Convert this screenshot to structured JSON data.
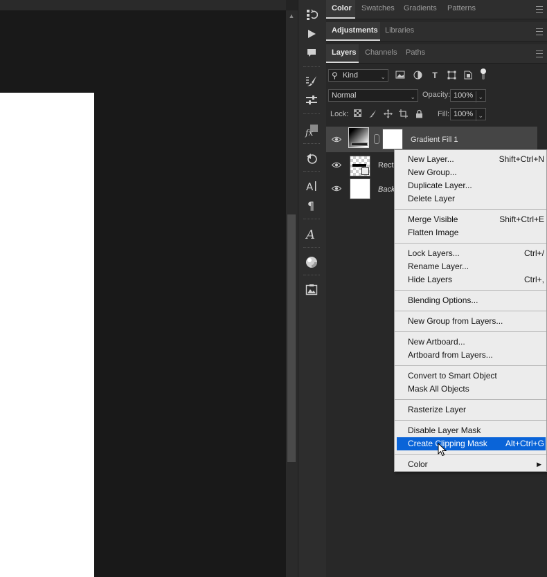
{
  "panels": {
    "row1_tabs": [
      "Color",
      "Swatches",
      "Gradients",
      "Patterns"
    ],
    "row2_tabs": [
      "Adjustments",
      "Libraries"
    ],
    "row3_tabs": [
      "Layers",
      "Channels",
      "Paths"
    ]
  },
  "layers_panel": {
    "filter_kind": "Kind",
    "blend_mode": "Normal",
    "opacity_label": "Opacity:",
    "opacity_value": "100%",
    "lock_label": "Lock:",
    "fill_label": "Fill:",
    "fill_value": "100%",
    "layers": [
      {
        "name": "Gradient Fill 1",
        "selected": true
      },
      {
        "name": "Recta"
      },
      {
        "name": "Backg",
        "italic": true
      }
    ]
  },
  "context_menu": {
    "groups": [
      [
        {
          "label": "New Layer...",
          "shortcut": "Shift+Ctrl+N"
        },
        {
          "label": "New Group...",
          "shortcut": ""
        },
        {
          "label": "Duplicate Layer...",
          "shortcut": ""
        },
        {
          "label": "Delete Layer",
          "shortcut": ""
        }
      ],
      [
        {
          "label": "Merge Visible",
          "shortcut": "Shift+Ctrl+E"
        },
        {
          "label": "Flatten Image",
          "shortcut": ""
        }
      ],
      [
        {
          "label": "Lock Layers...",
          "shortcut": "Ctrl+/"
        },
        {
          "label": "Rename Layer...",
          "shortcut": ""
        },
        {
          "label": "Hide Layers",
          "shortcut": "Ctrl+,"
        }
      ],
      [
        {
          "label": "Blending Options...",
          "shortcut": ""
        }
      ],
      [
        {
          "label": "New Group from Layers...",
          "shortcut": ""
        }
      ],
      [
        {
          "label": "New Artboard...",
          "shortcut": ""
        },
        {
          "label": "Artboard from Layers...",
          "shortcut": ""
        }
      ],
      [
        {
          "label": "Convert to Smart Object",
          "shortcut": ""
        },
        {
          "label": "Mask All Objects",
          "shortcut": ""
        }
      ],
      [
        {
          "label": "Rasterize Layer",
          "shortcut": ""
        }
      ],
      [
        {
          "label": "Disable Layer Mask",
          "shortcut": ""
        },
        {
          "label": "Create Clipping Mask",
          "shortcut": "Alt+Ctrl+G",
          "highlighted": true
        }
      ],
      [
        {
          "label": "Color",
          "shortcut": "",
          "submenu": true
        }
      ]
    ]
  },
  "colors": {
    "highlight": "#0a64d8",
    "canvas_bg": "#191919",
    "panel_bg": "#282828"
  }
}
